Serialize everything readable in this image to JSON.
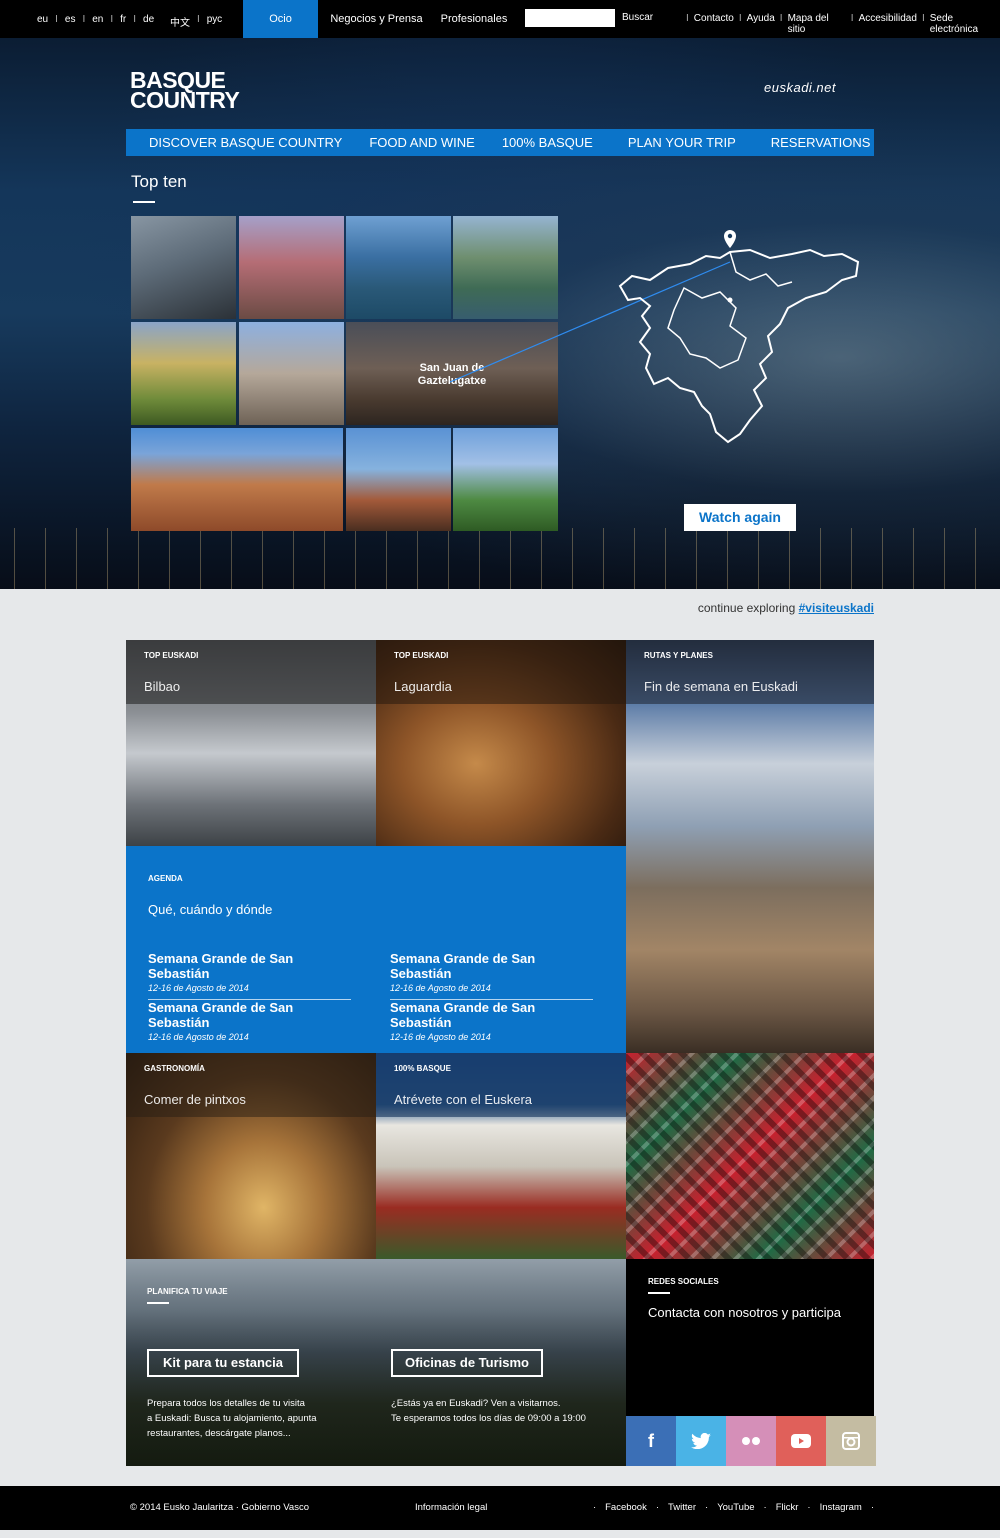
{
  "topbar": {
    "languages": [
      "eu",
      "es",
      "en",
      "fr",
      "de"
    ],
    "languages_other": [
      "中文",
      "рус"
    ],
    "tabs": [
      "Ocio",
      "Negocios y Prensa",
      "Profesionales"
    ],
    "search_button": "Buscar",
    "utility_links": [
      "Contacto",
      "Ayuda",
      "Mapa del sitio",
      "Accesibilidad",
      "Sede electrónica"
    ]
  },
  "header": {
    "logo_line1": "BASQUE",
    "logo_line2": "COUNTRY",
    "partner": "euskadi.net"
  },
  "nav": [
    "DISCOVER BASQUE COUNTRY",
    "FOOD AND WINE",
    "100% BASQUE",
    "PLAN YOUR TRIP",
    "RESERVATIONS"
  ],
  "topten": {
    "title": "Top ten",
    "featured_label_line1": "San Juan de",
    "featured_label_line2": "Gaztelugatxe",
    "watch_button": "Watch again"
  },
  "continue": {
    "text": "continue exploring",
    "hashtag": "#visiteuskadi"
  },
  "cards": {
    "bilbao": {
      "kicker": "TOP EUSKADI",
      "title": "Bilbao"
    },
    "laguardia": {
      "kicker": "TOP EUSKADI",
      "title": "Laguardia"
    },
    "rutas": {
      "kicker": "RUTAS Y PLANES",
      "title": "Fin de semana en Euskadi"
    },
    "gastronomia": {
      "kicker": "GASTRONOMÍA",
      "title": "Comer de pintxos"
    },
    "basque": {
      "kicker": "100% BASQUE",
      "title": "Atrévete con el Euskera"
    }
  },
  "agenda": {
    "kicker": "AGENDA",
    "subtitle": "Qué, cuándo y dónde",
    "events": [
      {
        "title": "Semana Grande de San Sebastián",
        "date": "12-16 de Agosto de 2014"
      },
      {
        "title": "Semana Grande de San Sebastián",
        "date": "12-16 de Agosto de 2014"
      },
      {
        "title": "Semana Grande de San Sebastián",
        "date": "12-16 de Agosto de 2014"
      },
      {
        "title": "Semana Grande de San Sebastián",
        "date": "12-16 de Agosto de 2014"
      }
    ]
  },
  "planifica": {
    "kicker": "PLANIFICA TU VIAJE",
    "kit_button": "Kit para tu estancia",
    "kit_desc_1": "Prepara todos los detalles de tu visita",
    "kit_desc_2": "a Euskadi: Busca tu alojamiento, apunta",
    "kit_desc_3": "restaurantes, descárgate planos...",
    "oficinas_button": "Oficinas de Turismo",
    "oficinas_desc_1": "¿Estás ya en Euskadi? Ven a visitarnos.",
    "oficinas_desc_2": "Te esperamos todos los días de 09:00 a 19:00"
  },
  "social": {
    "kicker": "REDES SOCIALES",
    "title": "Contacta con nosotros y participa",
    "buttons": [
      {
        "name": "facebook-icon",
        "glyph": "f",
        "color": "#3b6fb6"
      },
      {
        "name": "twitter-icon",
        "glyph": "t",
        "color": "#4ab3e6"
      },
      {
        "name": "flickr-icon",
        "glyph": "••",
        "color": "#d58fb8"
      },
      {
        "name": "youtube-icon",
        "glyph": "▶",
        "color": "#e0605a"
      },
      {
        "name": "instagram-icon",
        "glyph": "◘",
        "color": "#c4bca2"
      }
    ]
  },
  "footer": {
    "copyright": "© 2014 Eusko Jaularitza · Gobierno Vasco",
    "legal": "Información legal",
    "socials": [
      "Facebook",
      "Twitter",
      "YouTube",
      "Flickr",
      "Instagram"
    ]
  },
  "colors": {
    "accent": "#0b74c9",
    "topbar": "#000000"
  }
}
